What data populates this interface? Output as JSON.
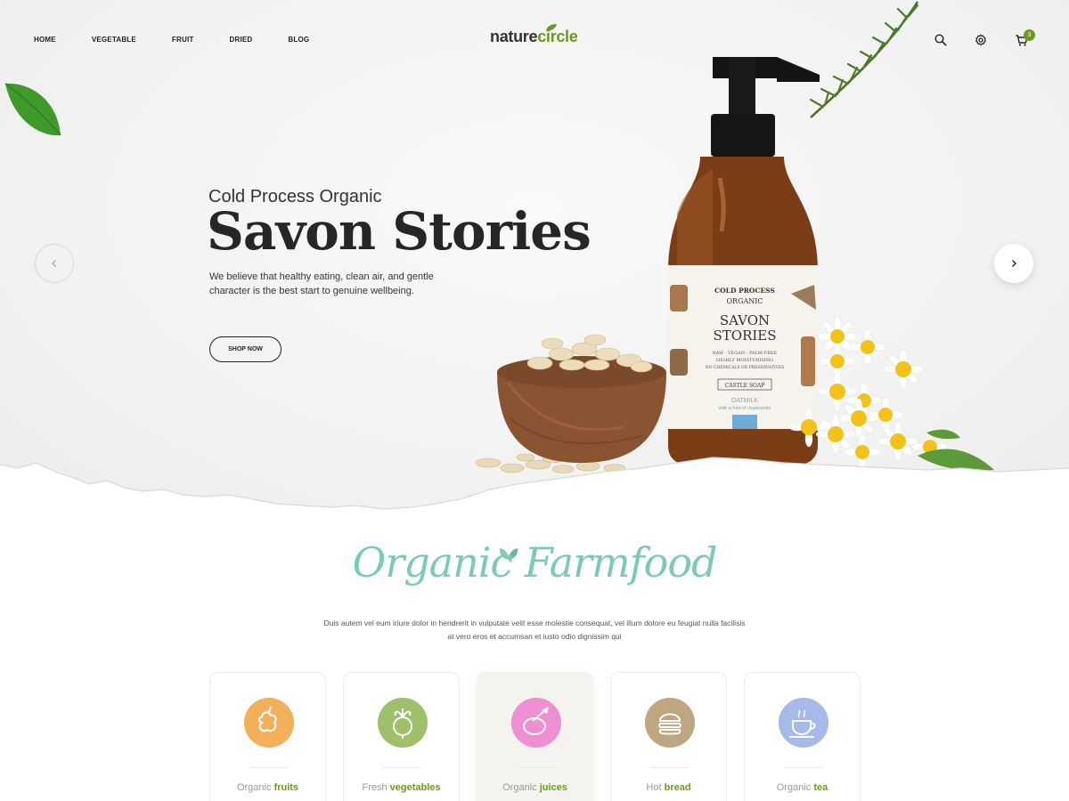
{
  "nav": {
    "items": [
      "HOME",
      "VEGETABLE",
      "FRUIT",
      "DRIED",
      "BLOG"
    ]
  },
  "logo": {
    "part1": "nature",
    "part2": "circle"
  },
  "header_icons": [
    "search-icon",
    "gear-icon",
    "cart-icon"
  ],
  "cart": {
    "count": "3"
  },
  "hero": {
    "subtitle": "Cold Process Organic",
    "title": "Savon Stories",
    "description": "We believe that healthy eating, clean air, and gentle character is the best start to genuine wellbeing.",
    "cta": "SHOP NOW",
    "label": {
      "line1": "COLD PROCESS",
      "line2": "ORGANIC",
      "name1": "SAVON",
      "name2": "STORIES",
      "small1": "RAW · VEGAN · PALM-FREE",
      "small2": "HIGHLY MOISTURISING",
      "small3": "NO CHEMICALS OR PRESERVATIVES",
      "box": "CASTLE SOAP",
      "flavor": "OATMILK",
      "flavor_sub": "with a hint of chamomile"
    }
  },
  "section": {
    "title": "Organic Farmfood",
    "description": "Duis autem vel eum iriure dolor in hendrerit in vulputate velit esse molestie consequat, vel illum dolore eu feugiat nulla facilisis at vero eros et accumsan et iusto odio dignissim qui"
  },
  "categories": [
    {
      "pre": "Organic",
      "main": "fruits",
      "icon": "fruit-icon",
      "color": "#f3b05a"
    },
    {
      "pre": "Fresh",
      "main": "vegetables",
      "icon": "vegetable-icon",
      "color": "#9fc06a"
    },
    {
      "pre": "Organic",
      "main": "juices",
      "icon": "juice-icon",
      "color": "#ee8fd3"
    },
    {
      "pre": "Hot",
      "main": "bread",
      "icon": "burger-icon",
      "color": "#bea680"
    },
    {
      "pre": "Organic",
      "main": "tea",
      "icon": "tea-icon",
      "color": "#a6b9e8"
    }
  ],
  "colors": {
    "accent": "#6a9b1b",
    "title_script": "#7dc9b5"
  }
}
